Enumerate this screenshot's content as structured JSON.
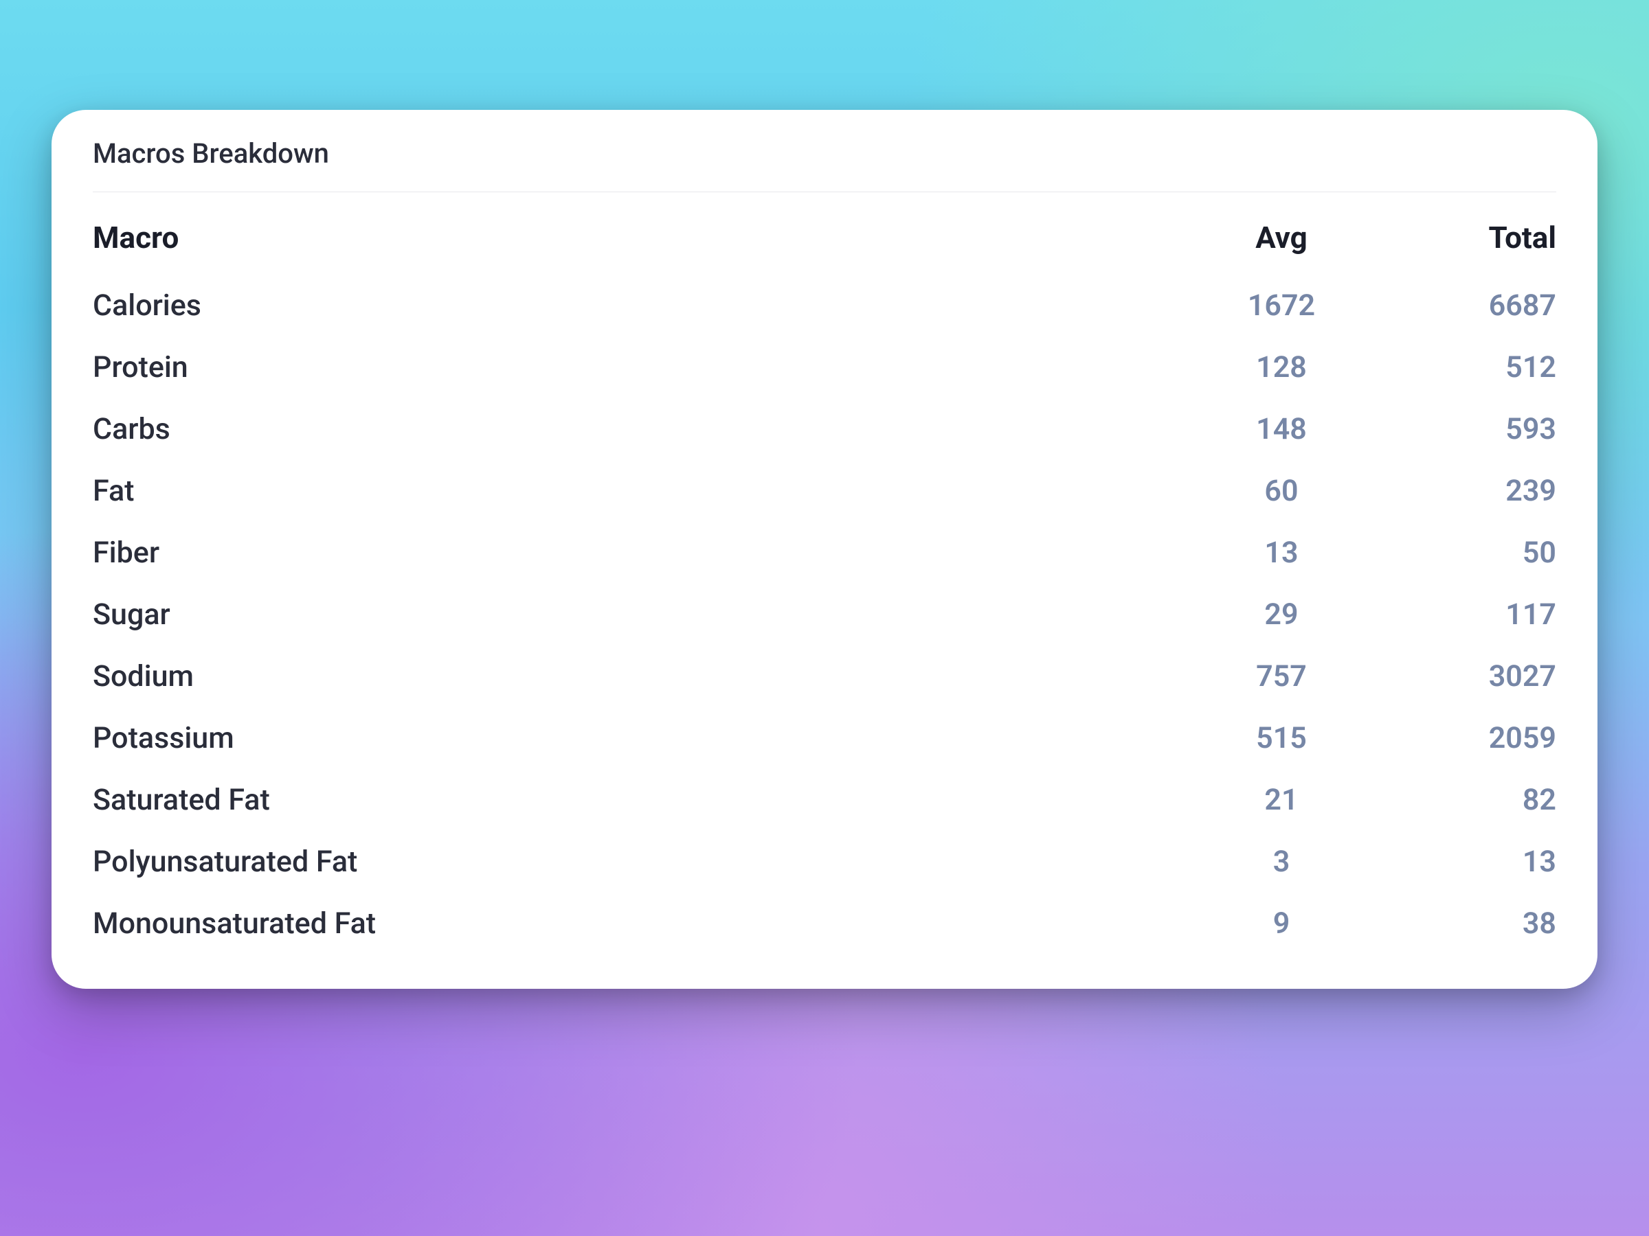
{
  "card": {
    "title": "Macros Breakdown",
    "headers": {
      "macro": "Macro",
      "avg": "Avg",
      "total": "Total"
    },
    "rows": [
      {
        "name": "Calories",
        "avg": "1672",
        "total": "6687"
      },
      {
        "name": "Protein",
        "avg": "128",
        "total": "512"
      },
      {
        "name": "Carbs",
        "avg": "148",
        "total": "593"
      },
      {
        "name": "Fat",
        "avg": "60",
        "total": "239"
      },
      {
        "name": "Fiber",
        "avg": "13",
        "total": "50"
      },
      {
        "name": "Sugar",
        "avg": "29",
        "total": "117"
      },
      {
        "name": "Sodium",
        "avg": "757",
        "total": "3027"
      },
      {
        "name": "Potassium",
        "avg": "515",
        "total": "2059"
      },
      {
        "name": "Saturated Fat",
        "avg": "21",
        "total": "82"
      },
      {
        "name": "Polyunsaturated Fat",
        "avg": "3",
        "total": "13"
      },
      {
        "name": "Monounsaturated Fat",
        "avg": "9",
        "total": "38"
      }
    ]
  }
}
